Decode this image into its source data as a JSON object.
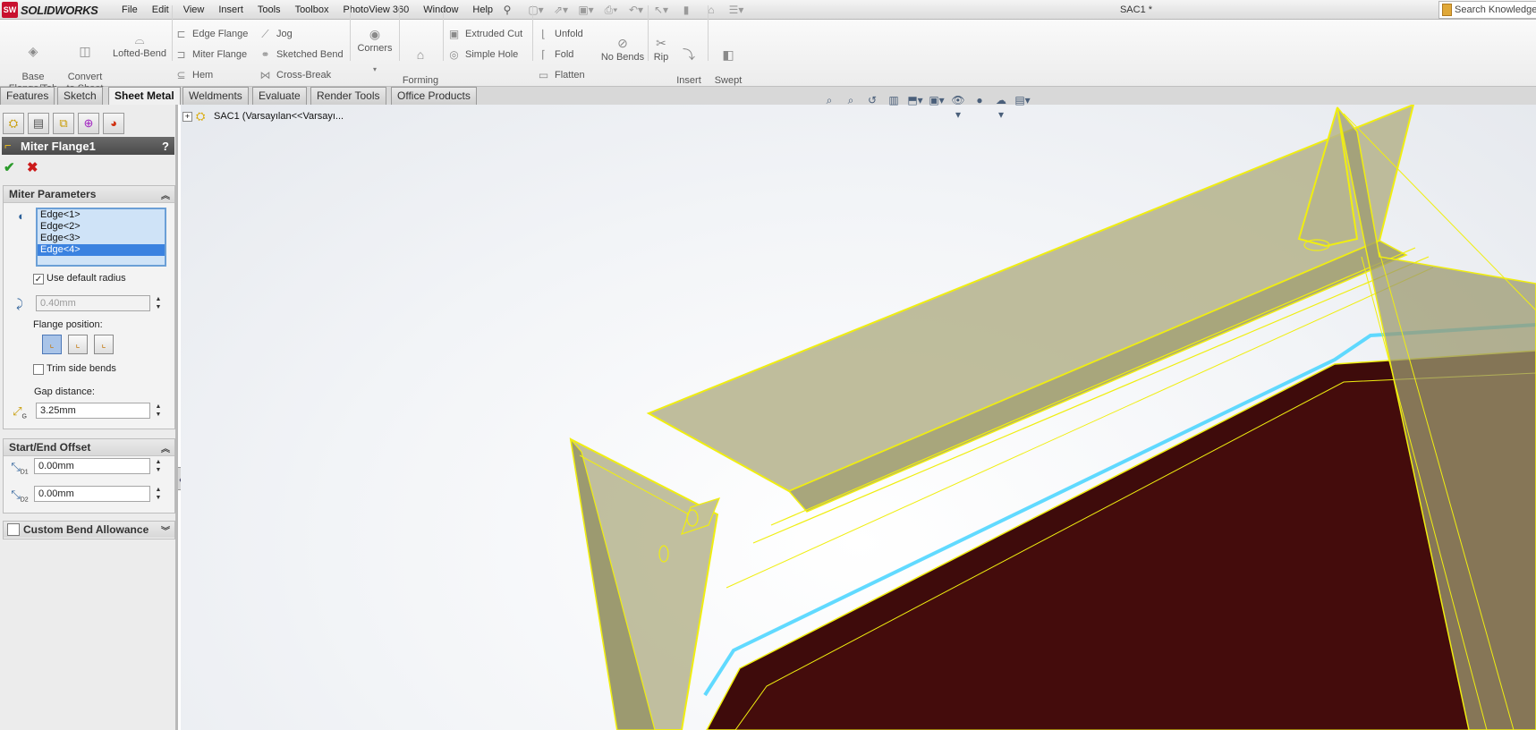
{
  "app": {
    "brand": "SOLIDWORKS",
    "logo_badge": "SW",
    "document_title": "SAC1 *"
  },
  "menu": [
    "File",
    "Edit",
    "View",
    "Insert",
    "Tools",
    "Toolbox",
    "PhotoView 360",
    "Window",
    "Help"
  ],
  "search": {
    "placeholder": "Search Knowledge"
  },
  "ribbon": {
    "base_flange": "Base\nFlange/Tab",
    "convert": "Convert\nto Sheet\nMetal",
    "lofted_bend": "Lofted-Bend",
    "edge_flange": "Edge Flange",
    "miter_flange": "Miter Flange",
    "hem": "Hem",
    "jog": "Jog",
    "sketched_bend": "Sketched Bend",
    "cross_break": "Cross-Break",
    "corners": "Corners",
    "forming_tool": "Forming\nTool",
    "extruded_cut": "Extruded Cut",
    "simple_hole": "Simple Hole",
    "unfold": "Unfold",
    "fold": "Fold",
    "flatten": "Flatten",
    "no_bends": "No Bends",
    "rip": "Rip",
    "insert_bends": "Insert\nBends",
    "swept_flange": "Swept\nFlange"
  },
  "tabs": [
    "Features",
    "Sketch",
    "Sheet Metal",
    "Weldments",
    "Evaluate",
    "Render Tools",
    "Office Products"
  ],
  "active_tab": "Sheet Metal",
  "property_manager": {
    "title": "Miter Flange1",
    "help": "?",
    "miter_parameters": {
      "header": "Miter Parameters",
      "edges": [
        "Edge<1>",
        "Edge<2>",
        "Edge<3>",
        "Edge<4>"
      ],
      "selected_edge": "Edge<4>",
      "use_default_radius_label": "Use default radius",
      "use_default_radius_checked": true,
      "radius_value": "0.40mm",
      "flange_position_label": "Flange position:",
      "trim_side_bends_label": "Trim side bends",
      "trim_side_bends_checked": false,
      "gap_distance_label": "Gap distance:",
      "gap_distance_value": "3.25mm",
      "gap_icon_sub": "G"
    },
    "start_end_offset": {
      "header": "Start/End Offset",
      "d1_value": "0.00mm",
      "d2_value": "0.00mm",
      "d1_sub": "D1",
      "d2_sub": "D2"
    },
    "custom_bend_allowance": {
      "header": "Custom Bend Allowance",
      "checked": false
    }
  },
  "tree": {
    "root_label": "SAC1  (Varsayılan<<Varsayı..."
  },
  "colors": {
    "flange_fill": "#b6b48e",
    "flange_edge": "#f0ee10",
    "body_fill": "#3e0b0b",
    "selection_edge": "#45d3ff",
    "pm_header": "#555555"
  }
}
